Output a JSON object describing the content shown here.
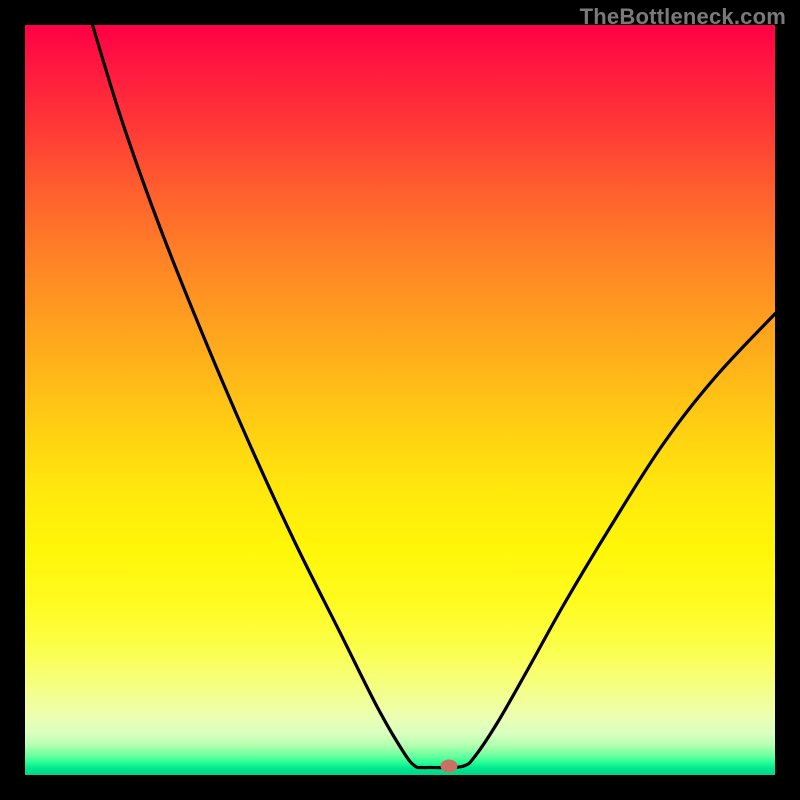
{
  "watermark": "TheBottleneck.com",
  "chart_data": {
    "type": "line",
    "title": "",
    "xlabel": "",
    "ylabel": "",
    "xlim": [
      0,
      100
    ],
    "ylim": [
      0,
      100
    ],
    "background": "red-to-green vertical gradient (bottleneck severity heatmap)",
    "grid": false,
    "legend": false,
    "series": [
      {
        "name": "bottleneck-curve",
        "description": "V-shaped curve with a flat minimum; left branch steeply descending, right branch rising with slight concave bend",
        "x": [
          9.0,
          13.0,
          18.0,
          24.0,
          30.0,
          36.0,
          42.0,
          47.0,
          50.5,
          52.0,
          53.0,
          54.0,
          56.0,
          58.5,
          60.0,
          63.0,
          67.0,
          72.0,
          78.0,
          85.0,
          92.0,
          100.0
        ],
        "y": [
          100.0,
          87.0,
          73.0,
          58.0,
          44.0,
          31.0,
          19.0,
          9.0,
          3.0,
          1.2,
          1.0,
          1.0,
          1.0,
          1.2,
          2.5,
          7.0,
          14.0,
          23.0,
          33.0,
          44.0,
          53.0,
          61.5
        ]
      }
    ],
    "marker": {
      "name": "optimal-point",
      "x": 56.5,
      "y": 1.2,
      "color": "#cb7062"
    },
    "band_colors": {
      "top": "#ff0044",
      "mid": "#ffe80c",
      "bottom": "#00d488"
    }
  },
  "layout": {
    "image_size": 800,
    "plot_inset": 25,
    "plot_size": 750
  }
}
